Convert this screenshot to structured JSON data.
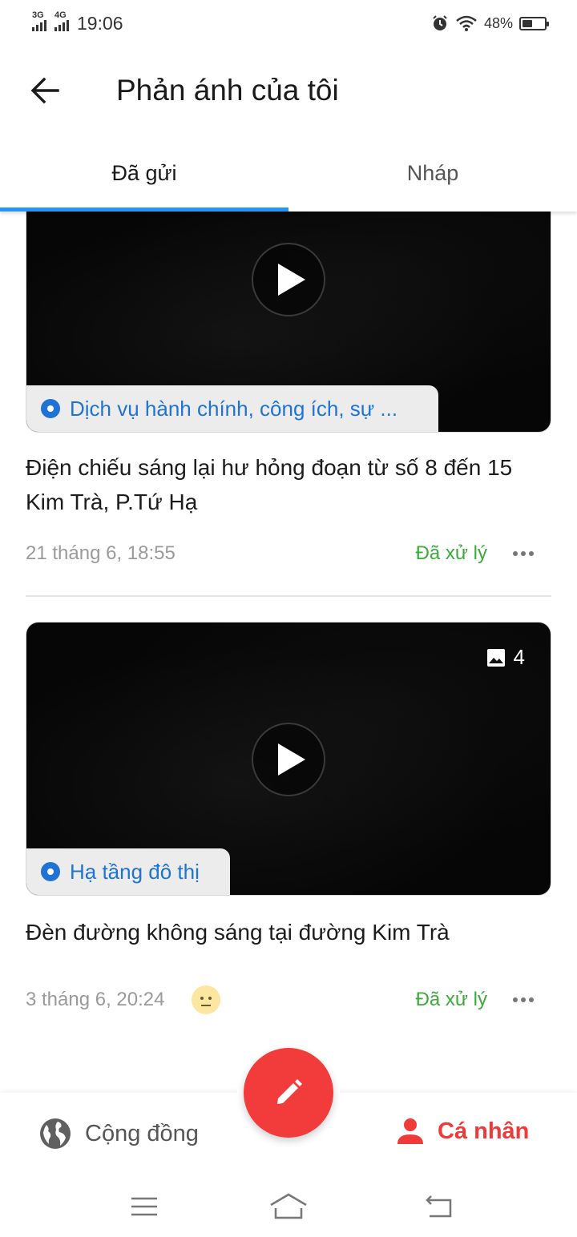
{
  "status_bar": {
    "network1": "3G",
    "network2": "4G",
    "time": "19:06",
    "battery": "48%",
    "battery_level": 0.48
  },
  "header": {
    "title": "Phản ánh của tôi",
    "back_icon": "arrow-left-icon"
  },
  "tabs": [
    {
      "label": "Đã gửi",
      "active": true
    },
    {
      "label": "Nháp",
      "active": false
    }
  ],
  "feedback_items": [
    {
      "category": "Dịch vụ hành chính, công ích, sự ...",
      "title": "Điện chiếu sáng lại hư hỏng đoạn từ số 8 đến 15 Kim Trà, P.Tứ Hạ",
      "date": "21 tháng 6, 18:55",
      "status": "Đã xử lý",
      "has_video": true
    },
    {
      "category": "Hạ tầng đô thị",
      "title": "Đèn đường không sáng tại đường Kim Trà",
      "date": "3 tháng 6, 20:24",
      "status": "Đã xử lý",
      "has_video": true,
      "photo_count": "4",
      "reaction_icon": "neutral-face-icon"
    }
  ],
  "bottom_nav": {
    "community_label": "Cộng đồng",
    "personal_label": "Cá nhân",
    "fab_icon": "pencil-icon"
  },
  "colors": {
    "accent_blue": "#2196f3",
    "category_blue": "#1f73d4",
    "status_green": "#3daa3d",
    "brand_red": "#f23b3b"
  }
}
